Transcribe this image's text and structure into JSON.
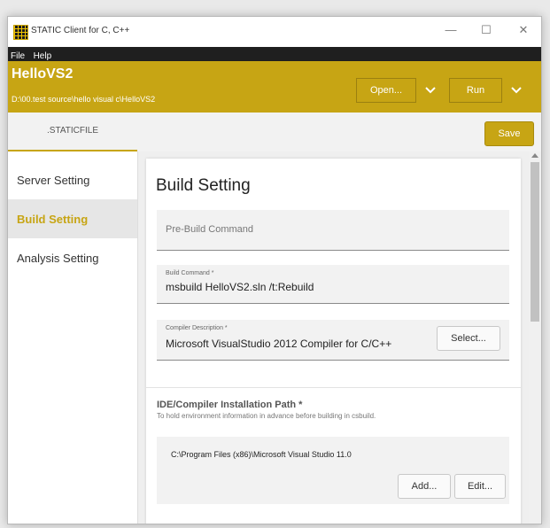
{
  "window": {
    "title": "STATIC Client for C, C++",
    "minimize_glyph": "—",
    "maximize_glyph": "☐",
    "close_glyph": "✕"
  },
  "menu": {
    "items": [
      "File",
      "Help"
    ]
  },
  "header": {
    "project_title": "HelloVS2",
    "project_path": "D:\\00.test source\\hello visual c\\HelloVS2",
    "open_label": "Open...",
    "run_label": "Run"
  },
  "tabs": {
    "staticfile_label": ".STATICFILE",
    "save_label": "Save"
  },
  "sidebar": {
    "items": [
      {
        "label": "Server Setting"
      },
      {
        "label": "Build Setting",
        "active": true
      },
      {
        "label": "Analysis Setting"
      }
    ]
  },
  "build": {
    "title": "Build Setting",
    "pre_build": {
      "placeholder": "Pre-Build Command"
    },
    "build_command": {
      "label": "Build Command *",
      "value": "msbuild HelloVS2.sln /t:Rebuild"
    },
    "compiler": {
      "label": "Compiler Description *",
      "value": "Microsoft VisualStudio 2012 Compiler for C/C++",
      "select_label": "Select..."
    },
    "ide": {
      "title": "IDE/Compiler Installation Path *",
      "description": "To hold environment information in advance before building in csbuild.",
      "path": "C:\\Program Files (x86)\\Microsoft Visual Studio 11.0",
      "add_label": "Add...",
      "edit_label": "Edit..."
    }
  },
  "colors": {
    "accent": "#c7a514",
    "menubar": "#1f1f1f"
  },
  "icons": [
    "app-icon",
    "minimize-icon",
    "maximize-icon",
    "close-icon",
    "chevron-down-icon",
    "scroll-up-icon"
  ]
}
